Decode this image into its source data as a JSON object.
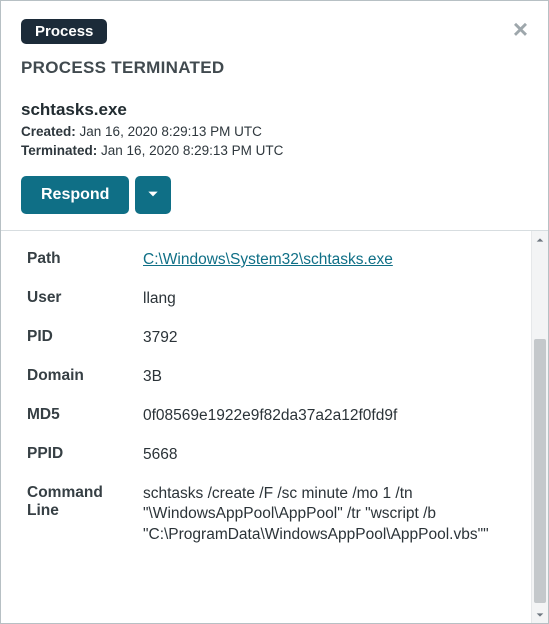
{
  "badge_label": "Process",
  "status_title": "PROCESS TERMINATED",
  "process_name": "schtasks.exe",
  "created_label": "Created:",
  "created_value": "Jan 16, 2020 8:29:13 PM UTC",
  "terminated_label": "Terminated:",
  "terminated_value": "Jan 16, 2020 8:29:13 PM UTC",
  "respond_label": "Respond",
  "details": {
    "path_label": "Path",
    "path_value": "C:\\Windows\\System32\\schtasks.exe",
    "user_label": "User",
    "user_value": "llang",
    "pid_label": "PID",
    "pid_value": "3792",
    "domain_label": "Domain",
    "domain_value": "3B",
    "md5_label": "MD5",
    "md5_value": "0f08569e1922e9f82da37a2a12f0fd9f",
    "ppid_label": "PPID",
    "ppid_value": "5668",
    "cmdline_label": "Command Line",
    "cmdline_value": "schtasks /create /F /sc minute /mo 1 /tn \"\\WindowsAppPool\\AppPool\" /tr \"wscript /b \"C:\\ProgramData\\WindowsAppPool\\AppPool.vbs\"\""
  }
}
